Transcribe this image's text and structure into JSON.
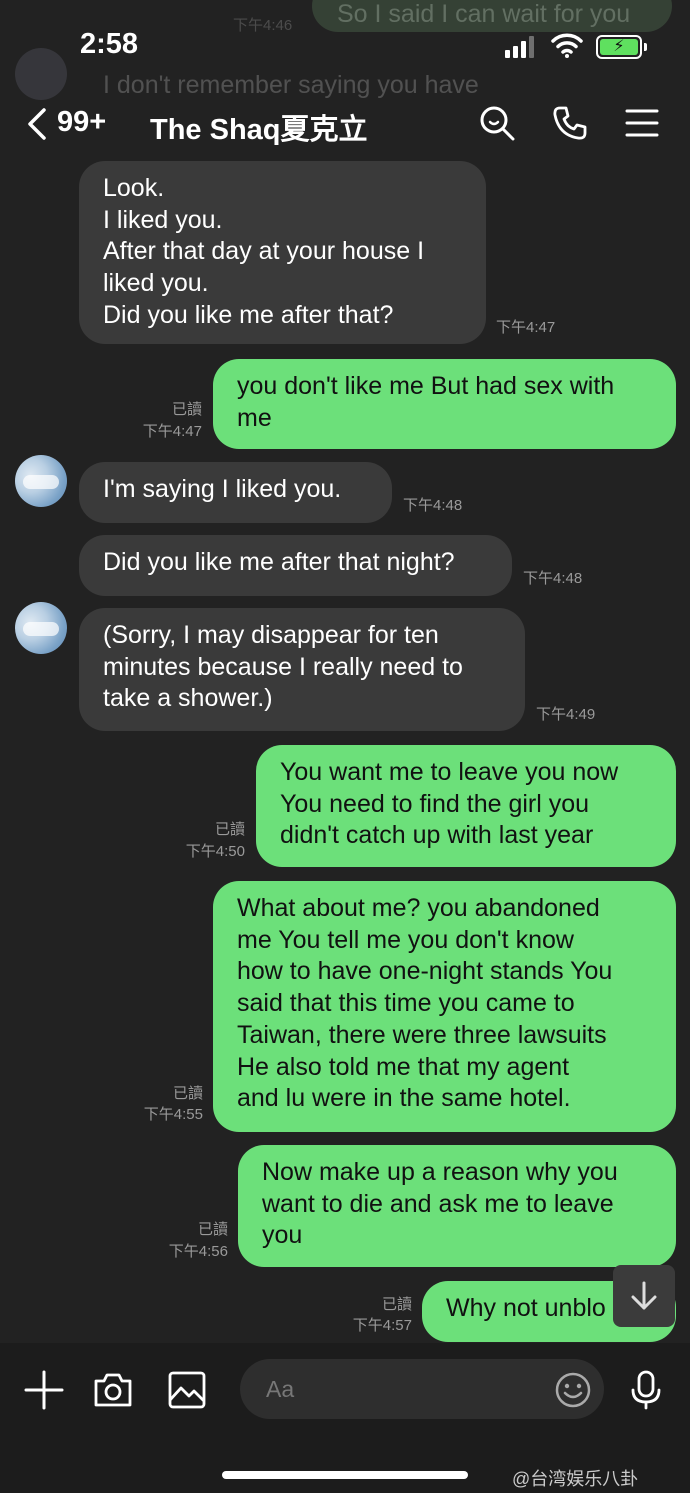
{
  "ghost": {
    "text_1": "So I said I can wait for you",
    "text_2": "I don't remember saying you have",
    "time": "下午4:46"
  },
  "status_bar": {
    "time": "2:58"
  },
  "header": {
    "back_count": "99+",
    "title": "The Shaq夏克立"
  },
  "messages": [
    {
      "side": "in",
      "text": "Look.\nI liked you.\nAfter that day at your house I\nliked you.\nDid you like me after that?",
      "time": "下午4:47"
    },
    {
      "side": "out",
      "text": "you don't like me But had sex with\nme",
      "read": "已讀",
      "time": "下午4:47"
    },
    {
      "side": "in",
      "text": "I'm saying I liked you.",
      "time": "下午4:48"
    },
    {
      "side": "in",
      "text": "Did you like me after that night?",
      "time": "下午4:48"
    },
    {
      "side": "in",
      "text": "(Sorry, I may disappear for ten\nminutes because I really need to\ntake a shower.)",
      "time": "下午4:49"
    },
    {
      "side": "out",
      "text": "You want me to leave you now\nYou need to find the girl you\ndidn't catch up with last year",
      "read": "已讀",
      "time": "下午4:50"
    },
    {
      "side": "out",
      "text": "What about me? you abandoned\nme You tell me you don't know\nhow to have one-night stands You\nsaid that this time you came to\nTaiwan, there were three lawsuits\nHe also told me that my agent\nand lu were in the same hotel.",
      "read": "已讀",
      "time": "下午4:55"
    },
    {
      "side": "out",
      "text": "Now make up a reason why you\nwant to die and ask me to leave\nyou",
      "read": "已讀",
      "time": "下午4:56"
    },
    {
      "side": "out",
      "text": "Why not unblo",
      "read": "已讀",
      "time": "下午4:57"
    }
  ],
  "input": {
    "placeholder": "Aa"
  },
  "icons": {
    "back": "chevron-left-icon",
    "search": "search-icon",
    "call": "phone-icon",
    "menu": "menu-icon",
    "plus": "plus-icon",
    "camera": "camera-icon",
    "image": "image-icon",
    "emoji": "emoji-icon",
    "mic": "microphone-icon",
    "scroll": "arrow-down-icon"
  },
  "colors": {
    "background": "#222222",
    "incoming_bubble": "#3a3a3a",
    "outgoing_bubble": "#6ce07a",
    "battery": "#5fe05f"
  },
  "watermark": "@台湾娱乐八卦"
}
